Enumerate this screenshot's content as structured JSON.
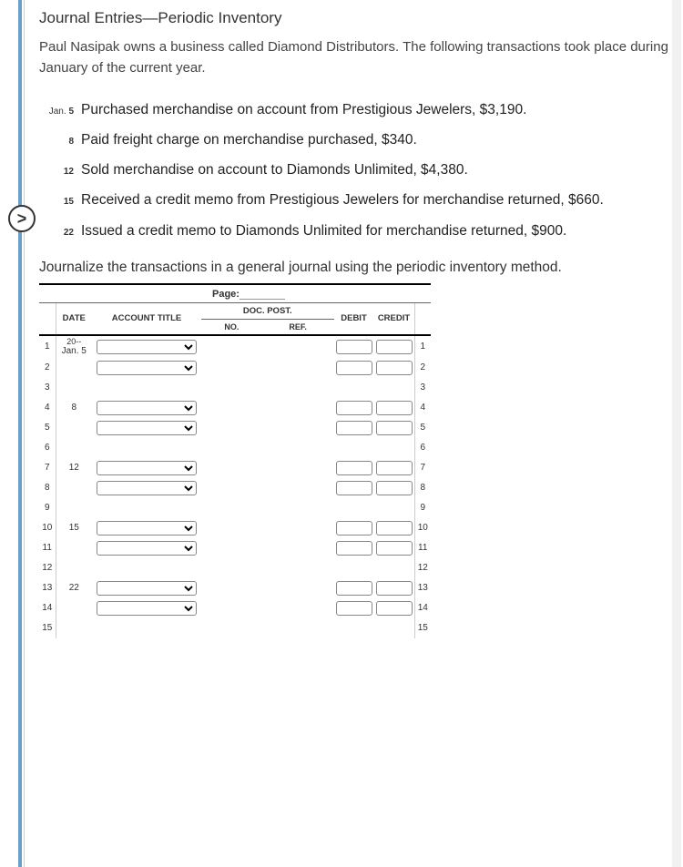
{
  "title": "Journal Entries—Periodic Inventory",
  "intro": "Paul Nasipak owns a business called Diamond Distributors. The following transactions took place during January of the current year.",
  "toggle_icon": ">",
  "transactions": [
    {
      "prefix": "Jan.",
      "day": "5",
      "text": "Purchased merchandise on account from Prestigious Jewelers, $3,190."
    },
    {
      "prefix": "",
      "day": "8",
      "text": "Paid freight charge on merchandise purchased, $340."
    },
    {
      "prefix": "",
      "day": "12",
      "text": "Sold merchandise on account to Diamonds Unlimited, $4,380."
    },
    {
      "prefix": "",
      "day": "15",
      "text": "Received a credit memo from Prestigious Jewelers for merchandise returned, $660."
    },
    {
      "prefix": "",
      "day": "22",
      "text": "Issued a credit memo to Diamonds Unlimited for merchandise returned, $900."
    }
  ],
  "instruction": "Journalize the transactions in a general journal using the periodic inventory method.",
  "journal": {
    "page_label": "Page:",
    "headers": {
      "date": "DATE",
      "account": "ACCOUNT TITLE",
      "docpost": "DOC. POST.",
      "doc_no": "NO.",
      "doc_ref": "REF.",
      "debit": "DEBIT",
      "credit": "CREDIT"
    },
    "rows": [
      {
        "n": "1",
        "year": "20--",
        "date": "Jan. 5",
        "acct": true,
        "debit": true,
        "credit": true
      },
      {
        "n": "2",
        "year": "",
        "date": "",
        "acct": true,
        "debit": true,
        "credit": true
      },
      {
        "n": "3",
        "year": "",
        "date": "",
        "acct": false,
        "debit": false,
        "credit": false
      },
      {
        "n": "4",
        "year": "",
        "date": "8",
        "acct": true,
        "debit": true,
        "credit": true
      },
      {
        "n": "5",
        "year": "",
        "date": "",
        "acct": true,
        "debit": true,
        "credit": true
      },
      {
        "n": "6",
        "year": "",
        "date": "",
        "acct": false,
        "debit": false,
        "credit": false
      },
      {
        "n": "7",
        "year": "",
        "date": "12",
        "acct": true,
        "debit": true,
        "credit": true
      },
      {
        "n": "8",
        "year": "",
        "date": "",
        "acct": true,
        "debit": true,
        "credit": true
      },
      {
        "n": "9",
        "year": "",
        "date": "",
        "acct": false,
        "debit": false,
        "credit": false
      },
      {
        "n": "10",
        "year": "",
        "date": "15",
        "acct": true,
        "debit": true,
        "credit": true
      },
      {
        "n": "11",
        "year": "",
        "date": "",
        "acct": true,
        "debit": true,
        "credit": true
      },
      {
        "n": "12",
        "year": "",
        "date": "",
        "acct": false,
        "debit": false,
        "credit": false
      },
      {
        "n": "13",
        "year": "",
        "date": "22",
        "acct": true,
        "debit": true,
        "credit": true
      },
      {
        "n": "14",
        "year": "",
        "date": "",
        "acct": true,
        "debit": true,
        "credit": true
      },
      {
        "n": "15",
        "year": "",
        "date": "",
        "acct": false,
        "debit": false,
        "credit": false
      }
    ]
  }
}
